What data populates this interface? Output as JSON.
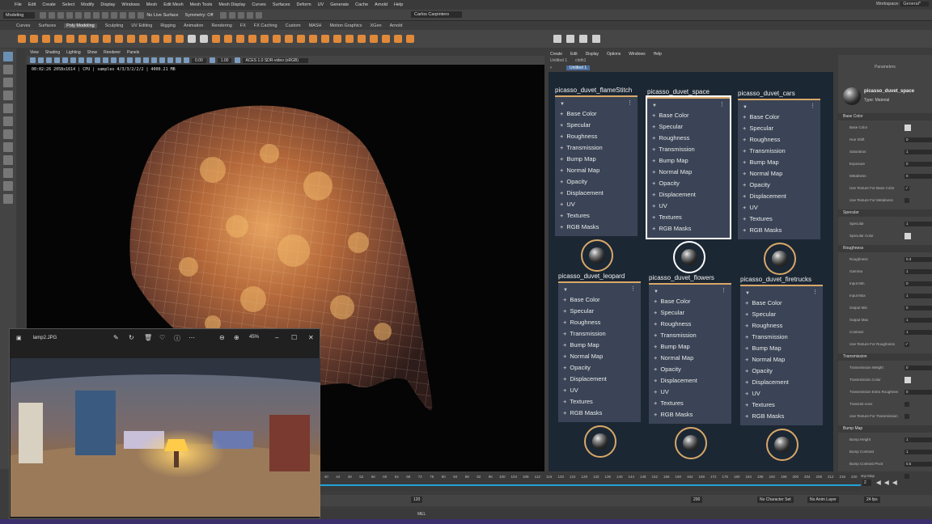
{
  "menu": [
    "File",
    "Edit",
    "Create",
    "Select",
    "Modify",
    "Display",
    "Windows",
    "Mesh",
    "Edit Mesh",
    "Mesh Tools",
    "Mesh Display",
    "Curves",
    "Surfaces",
    "Deform",
    "UV",
    "Generate",
    "Cache",
    "Arnold",
    "Help"
  ],
  "workspace": {
    "label": "Workspace:",
    "value": "General*"
  },
  "statusline": {
    "mode": "Modeling",
    "live_surface": "No Live Surface",
    "symmetry": "Symmetry: Off",
    "user": "Carlos Carpintero"
  },
  "shelf_tabs": [
    "Curves",
    "Surfaces",
    "Poly Modeling",
    "Sculpting",
    "UV Editing",
    "Rigging",
    "Animation",
    "Rendering",
    "FX",
    "FX Caching",
    "Custom",
    "MASH",
    "Motion Graphics",
    "XGen",
    "Arnold"
  ],
  "shelf_tabs_active": "Poly Modeling",
  "viewport": {
    "menu": [
      "View",
      "Shading",
      "Lighting",
      "Show",
      "Renderer",
      "Panels"
    ],
    "field_a": "0.00",
    "field_b": "1.00",
    "colorspace": "ACES 1.0 SDR-video (sRGB)",
    "hud": "00:02:26  2058x1614 | CPU | samples 4/3/3/2/2/2 | 4000.21 MB"
  },
  "viewer": {
    "filename": "lamp2.JPG",
    "zoom": "45%"
  },
  "hypershade": {
    "tabs": [
      "Create",
      "Edit",
      "Display",
      "Options",
      "Windows",
      "Help"
    ],
    "docs": [
      "Untitled 1",
      "cloth1"
    ],
    "current_tab": "Untitled 1",
    "channels": [
      "Base Color",
      "Specular",
      "Roughness",
      "Transmission",
      "Bump Map",
      "Normal Map",
      "Opacity",
      "Displacement",
      "UV",
      "Textures",
      "RGB Masks"
    ],
    "nodes": [
      {
        "name": "picasso_duvet_flameStitch"
      },
      {
        "name": "picasso_duvet_space"
      },
      {
        "name": "picasso_duvet_cars"
      },
      {
        "name": "picasso_duvet_leopard"
      },
      {
        "name": "picasso_duvet_flowers"
      },
      {
        "name": "picasso_duvet_firetrucks"
      }
    ],
    "selected": "picasso_duvet_space"
  },
  "attribute_editor": {
    "tabs": [
      "Parameters",
      "Info"
    ],
    "header": "Parameters",
    "material_name": "picasso_duvet_space",
    "material_type": "Type: Material",
    "sections": [
      {
        "title": "Base Color",
        "rows": [
          {
            "label": "Base Color",
            "kind": "swatch"
          },
          {
            "label": "Hue Shift",
            "value": "0"
          },
          {
            "label": "Saturation",
            "value": "1"
          },
          {
            "label": "Exposure",
            "value": "0"
          },
          {
            "label": "Metalness",
            "value": "0"
          },
          {
            "label": "Use Texture For  Base  Color",
            "kind": "check",
            "value": "✓"
          },
          {
            "label": "Use Texture For  Metalness",
            "kind": "check",
            "value": ""
          }
        ]
      },
      {
        "title": "Specular",
        "rows": [
          {
            "label": "Specular",
            "value": "1"
          },
          {
            "label": "Specular Color",
            "kind": "swatch"
          }
        ]
      },
      {
        "title": "Roughness",
        "rows": [
          {
            "label": "Roughness",
            "value": "0.3"
          },
          {
            "label": "Gamma",
            "value": "1"
          },
          {
            "label": "Input Min",
            "value": "0"
          },
          {
            "label": "Input Max",
            "value": "1"
          },
          {
            "label": "Output Min",
            "value": "0"
          },
          {
            "label": "Output Max",
            "value": "1"
          },
          {
            "label": "Contrast",
            "value": "1"
          },
          {
            "label": "Use Texture For  Roughness",
            "kind": "check",
            "value": "✓"
          }
        ]
      },
      {
        "title": "Transmission",
        "rows": [
          {
            "label": "Transmission  Weight",
            "value": "0"
          },
          {
            "label": "Transmission Color",
            "kind": "swatch"
          },
          {
            "label": "Transmission Extra Roughnes",
            "value": "0"
          },
          {
            "label": "Transmit Aovs",
            "kind": "check",
            "value": ""
          },
          {
            "label": "Use Texture For  Transmission",
            "kind": "check",
            "value": ""
          }
        ]
      },
      {
        "title": "Bump Map",
        "rows": [
          {
            "label": "Bump Height",
            "value": "1"
          },
          {
            "label": "Bump  Contrast",
            "value": "1"
          },
          {
            "label": "Bump  Contrast  Pivot",
            "value": "0.5"
          },
          {
            "label": "Use  Bump  Map",
            "kind": "check",
            "value": ""
          }
        ]
      }
    ]
  },
  "timeline": {
    "ticks": [
      "40",
      "44",
      "48",
      "52",
      "56",
      "60",
      "64",
      "68",
      "72",
      "76",
      "80",
      "84",
      "88",
      "92",
      "96",
      "100",
      "104",
      "108",
      "112",
      "116",
      "120",
      "124",
      "128",
      "132",
      "136",
      "140",
      "144",
      "148",
      "152",
      "156",
      "160",
      "164",
      "168",
      "172",
      "176",
      "180",
      "184",
      "188",
      "192",
      "196",
      "200",
      "204",
      "208",
      "212",
      "216",
      "220"
    ],
    "current_frame": "2",
    "range_end": "120",
    "range_max": "200",
    "character_set": "No Character Set",
    "anim_layer": "No Anim Layer",
    "fps": "24 fps",
    "mel": "MEL"
  },
  "colors": {
    "accent": "#d9a868",
    "canvas": "#1c2734",
    "node": "#3a4456",
    "timeline": "#1fa3d8"
  }
}
